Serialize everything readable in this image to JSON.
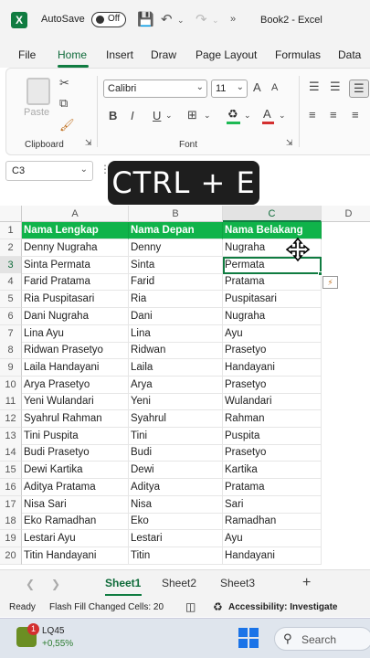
{
  "titlebar": {
    "autosave_label": "AutoSave",
    "toggle_state": "Off",
    "doc_title": "Book2 - Excel"
  },
  "ribbon_tabs": [
    "File",
    "Home",
    "Insert",
    "Draw",
    "Page Layout",
    "Formulas",
    "Data"
  ],
  "active_tab": "Home",
  "ribbon": {
    "paste_label": "Paste",
    "clipboard_label": "Clipboard",
    "font_name": "Calibri",
    "font_size": "11",
    "font_label": "Font",
    "bold": "B",
    "italic": "I",
    "underline": "U",
    "font_color": "A",
    "grow_font": "A",
    "shrink_font": "A"
  },
  "formula_bar": {
    "name_box": "C3"
  },
  "overlay_text": "CTRL + E",
  "columns": [
    "A",
    "B",
    "C",
    "D"
  ],
  "selected_column": "C",
  "header_row": [
    "Nama Lengkap",
    "Nama Depan",
    "Nama Belakang"
  ],
  "rows": [
    [
      "Denny Nugraha",
      "Denny",
      "Nugraha"
    ],
    [
      "Sinta Permata",
      "Sinta",
      "Permata"
    ],
    [
      "Farid Pratama",
      "Farid",
      "Pratama"
    ],
    [
      "Ria Puspitasari",
      "Ria",
      "Puspitasari"
    ],
    [
      "Dani Nugraha",
      "Dani",
      "Nugraha"
    ],
    [
      "Lina Ayu",
      "Lina",
      "Ayu"
    ],
    [
      "Ridwan Prasetyo",
      "Ridwan",
      "Prasetyo"
    ],
    [
      "Laila Handayani",
      "Laila",
      "Handayani"
    ],
    [
      "Arya Prasetyo",
      "Arya",
      "Prasetyo"
    ],
    [
      "Yeni Wulandari",
      "Yeni",
      "Wulandari"
    ],
    [
      "Syahrul Rahman",
      "Syahrul",
      "Rahman"
    ],
    [
      "Tini Puspita",
      "Tini",
      "Puspita"
    ],
    [
      "Budi Prasetyo",
      "Budi",
      "Prasetyo"
    ],
    [
      "Dewi Kartika",
      "Dewi",
      "Kartika"
    ],
    [
      "Aditya Pratama",
      "Aditya",
      "Pratama"
    ],
    [
      "Nisa Sari",
      "Nisa",
      "Sari"
    ],
    [
      "Eko Ramadhan",
      "Eko",
      "Ramadhan"
    ],
    [
      "Lestari Ayu",
      "Lestari",
      "Ayu"
    ],
    [
      "Titin Handayani",
      "Titin",
      "Handayani"
    ]
  ],
  "selected_row_number": "3",
  "sheets": [
    "Sheet1",
    "Sheet2",
    "Sheet3"
  ],
  "active_sheet": "Sheet1",
  "statusbar": {
    "ready": "Ready",
    "flash_fill": "Flash Fill Changed Cells: 20",
    "accessibility": "Accessibility: Investigate"
  },
  "taskbar": {
    "badge_count": "1",
    "stock_name": "LQ45",
    "stock_change": "+0,55%",
    "search_label": "Search"
  },
  "colors": {
    "accent": "#107c41",
    "header_fill": "#10b34a",
    "overlay_bg": "#1e1e1e"
  }
}
